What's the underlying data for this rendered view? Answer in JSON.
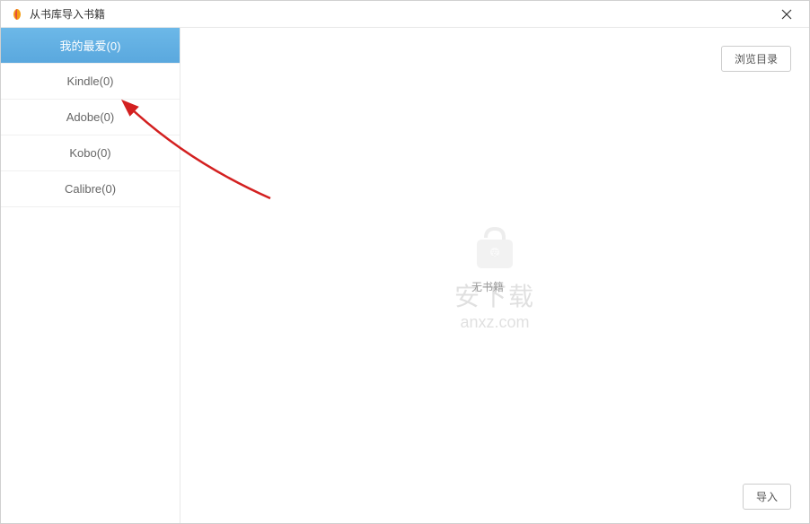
{
  "titlebar": {
    "title": "从书库导入书籍"
  },
  "sidebar": {
    "items": [
      {
        "label": "我的最爱(0)",
        "active": true
      },
      {
        "label": "Kindle(0)",
        "active": false
      },
      {
        "label": "Adobe(0)",
        "active": false
      },
      {
        "label": "Kobo(0)",
        "active": false
      },
      {
        "label": "Calibre(0)",
        "active": false
      }
    ]
  },
  "buttons": {
    "browse_catalog": "浏览目录",
    "import": "导入"
  },
  "watermark": {
    "text": "安下载",
    "sub": "anxz.com"
  },
  "empty_text": "无书籍"
}
